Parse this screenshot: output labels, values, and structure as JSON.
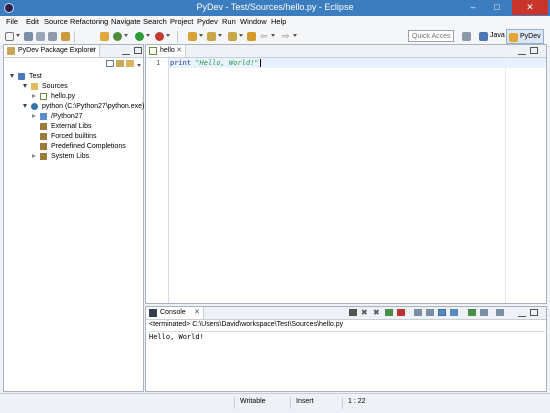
{
  "window": {
    "title": "PyDev - Test/Sources/hello.py - Eclipse",
    "minimize": "–",
    "maximize": "□",
    "close": "✕"
  },
  "menu": [
    "File",
    "Edit",
    "Source",
    "Refactoring",
    "Navigate",
    "Search",
    "Project",
    "Pydev",
    "Run",
    "Window",
    "Help"
  ],
  "toolbar": {
    "quick_access_placeholder": "Quick Access",
    "perspectives": [
      "Java",
      "PyDev"
    ]
  },
  "explorer": {
    "tab_label": "PyDev Package Explorer",
    "tree": [
      {
        "label": "Test",
        "expanded": true,
        "icon": "project-icon"
      },
      {
        "label": "Sources",
        "expanded": true,
        "icon": "source-folder-icon"
      },
      {
        "label": "hello.py",
        "expanded": false,
        "icon": "python-file-icon"
      },
      {
        "label": "python  (C:\\Python27\\python.exe)",
        "expanded": true,
        "icon": "python-interpreter-icon"
      },
      {
        "label": "/Python27",
        "expanded": false,
        "icon": "folder-icon"
      },
      {
        "label": "External Libs",
        "icon": "libs-icon"
      },
      {
        "label": "Forced builtins",
        "icon": "libs-icon"
      },
      {
        "label": "Predefined Completions",
        "icon": "libs-icon"
      },
      {
        "label": "System Libs",
        "expanded": false,
        "icon": "libs-icon"
      }
    ]
  },
  "editor": {
    "tab_label": "hello",
    "line_number": "1",
    "code_keyword": "print",
    "code_string": "\"Hello, World!\""
  },
  "console": {
    "tab_label": "Console",
    "terminated_line": "<terminated> C:\\Users\\David\\workspace\\Test\\Sources\\hello.py",
    "output": "Hello, World!"
  },
  "status": {
    "writable": "Writable",
    "insert": "Insert",
    "position": "1 : 22"
  },
  "colors": {
    "titlebar": "#3b7dbf",
    "close": "#c7352b",
    "keyword": "#1c39a3",
    "string": "#2a9b4a"
  }
}
